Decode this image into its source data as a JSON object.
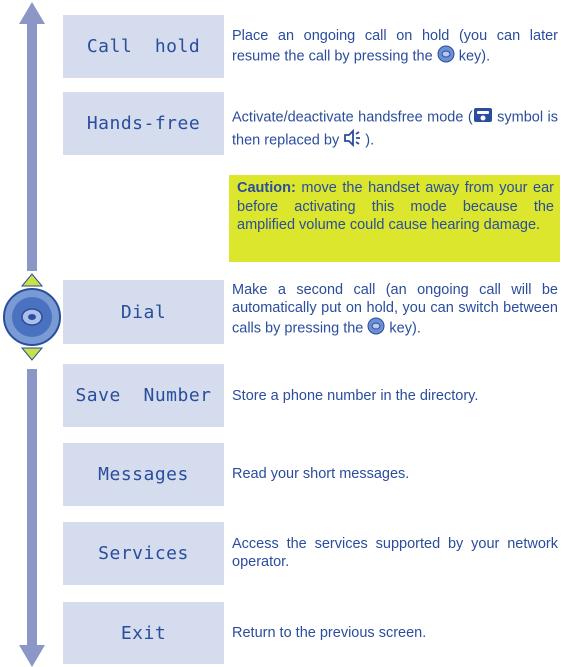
{
  "menu": [
    {
      "label": "Call  hold",
      "description": [
        "Place an ongoing call on hold (you can later resume the call by pressing the ",
        {
          "icon": "nav-key-icon"
        },
        " key)."
      ]
    },
    {
      "label": "Hands-free",
      "description": [
        "Activate/deactivate handsfree mode (",
        {
          "icon": "handset-icon"
        },
        " symbol is then replaced by ",
        {
          "icon": "speaker-icon"
        },
        ")."
      ]
    },
    {
      "label": "Dial",
      "description": [
        "Make a second call (an ongoing call will be automatically put on hold, you can switch between calls by pressing the ",
        {
          "icon": "nav-key-icon"
        },
        " key)."
      ]
    },
    {
      "label": "Save  Number",
      "description": [
        "Store a phone number in the directory."
      ]
    },
    {
      "label": "Messages",
      "description": [
        "Read your short messages."
      ]
    },
    {
      "label": "Services",
      "description": [
        "Access the services supported by your network operator."
      ]
    },
    {
      "label": "Exit",
      "description": [
        "Return to the previous screen."
      ]
    }
  ],
  "caution": {
    "title": "Caution:",
    "text": " move the handset away from your ear before activating this mode because the amplified volume could cause hearing damage."
  },
  "colors": {
    "text": "#2a4d9c",
    "box": "#d4dcee",
    "caution_bg": "#dbe62d",
    "rail": "#8a97c7"
  }
}
